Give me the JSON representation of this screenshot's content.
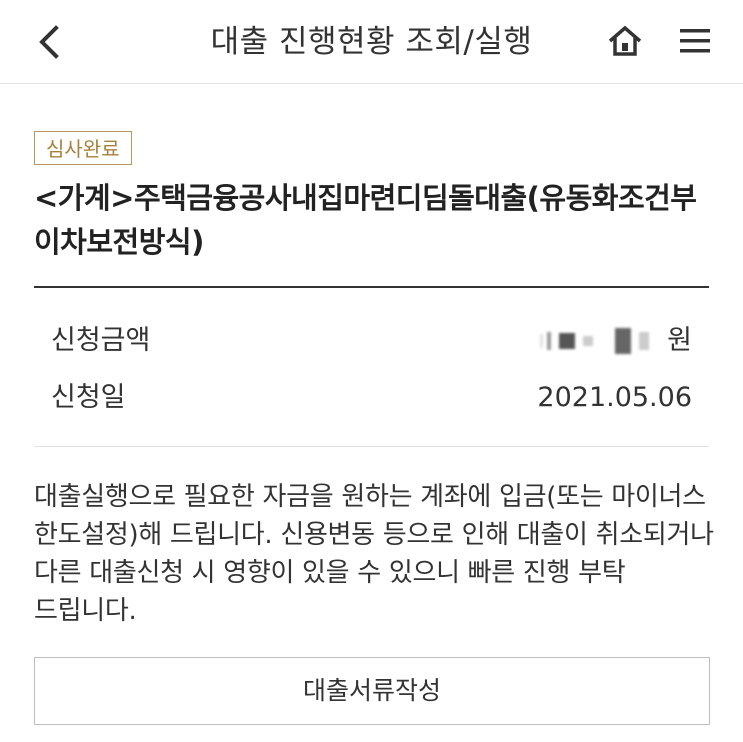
{
  "header": {
    "title": "대출 진행현황 조회/실행",
    "back_icon": "chevron-left-icon",
    "home_icon": "home-icon",
    "menu_icon": "hamburger-menu-icon"
  },
  "loan": {
    "status_badge": "심사완료",
    "product_name": "<가계>주택금융공사내집마련디딤돌대출(유동화조건부 이차보전방식)",
    "amount": {
      "label": "신청금액",
      "currency": "원"
    },
    "date": {
      "label": "신청일",
      "value": "2021.05.06"
    }
  },
  "notice": {
    "text": "대출실행으로 필요한 자금을 원하는 계좌에 입금(또는 마이너스 한도설정)해 드립니다. 신용변동 등으로 인해 대출이 취소되거나 다른 대출신청 시 영향이 있을 수 있으니 빠른 진행 부탁 드립니다."
  },
  "actions": {
    "document_button": "대출서류작성"
  },
  "colors": {
    "badge_border": "#b9975b",
    "badge_text": "#a6823c",
    "divider": "#333333"
  }
}
